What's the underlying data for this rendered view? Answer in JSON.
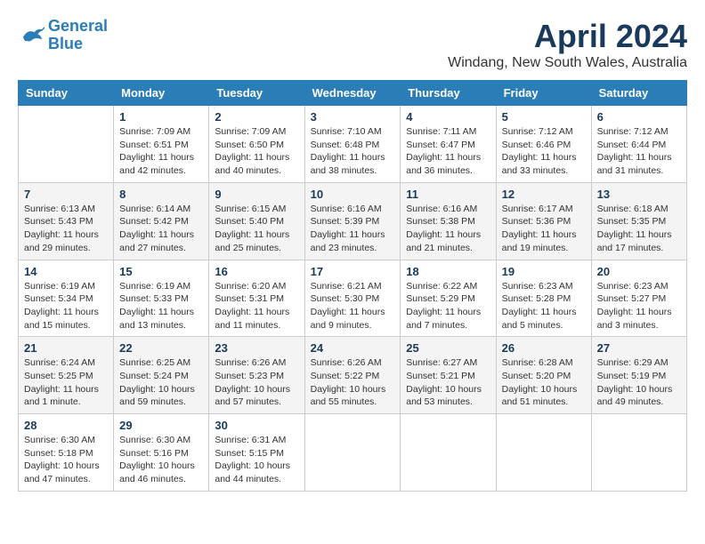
{
  "header": {
    "logo_line1": "General",
    "logo_line2": "Blue",
    "month_title": "April 2024",
    "location": "Windang, New South Wales, Australia"
  },
  "days_of_week": [
    "Sunday",
    "Monday",
    "Tuesday",
    "Wednesday",
    "Thursday",
    "Friday",
    "Saturday"
  ],
  "weeks": [
    [
      {
        "day": "",
        "info": ""
      },
      {
        "day": "1",
        "info": "Sunrise: 7:09 AM\nSunset: 6:51 PM\nDaylight: 11 hours\nand 42 minutes."
      },
      {
        "day": "2",
        "info": "Sunrise: 7:09 AM\nSunset: 6:50 PM\nDaylight: 11 hours\nand 40 minutes."
      },
      {
        "day": "3",
        "info": "Sunrise: 7:10 AM\nSunset: 6:48 PM\nDaylight: 11 hours\nand 38 minutes."
      },
      {
        "day": "4",
        "info": "Sunrise: 7:11 AM\nSunset: 6:47 PM\nDaylight: 11 hours\nand 36 minutes."
      },
      {
        "day": "5",
        "info": "Sunrise: 7:12 AM\nSunset: 6:46 PM\nDaylight: 11 hours\nand 33 minutes."
      },
      {
        "day": "6",
        "info": "Sunrise: 7:12 AM\nSunset: 6:44 PM\nDaylight: 11 hours\nand 31 minutes."
      }
    ],
    [
      {
        "day": "7",
        "info": "Sunrise: 6:13 AM\nSunset: 5:43 PM\nDaylight: 11 hours\nand 29 minutes."
      },
      {
        "day": "8",
        "info": "Sunrise: 6:14 AM\nSunset: 5:42 PM\nDaylight: 11 hours\nand 27 minutes."
      },
      {
        "day": "9",
        "info": "Sunrise: 6:15 AM\nSunset: 5:40 PM\nDaylight: 11 hours\nand 25 minutes."
      },
      {
        "day": "10",
        "info": "Sunrise: 6:16 AM\nSunset: 5:39 PM\nDaylight: 11 hours\nand 23 minutes."
      },
      {
        "day": "11",
        "info": "Sunrise: 6:16 AM\nSunset: 5:38 PM\nDaylight: 11 hours\nand 21 minutes."
      },
      {
        "day": "12",
        "info": "Sunrise: 6:17 AM\nSunset: 5:36 PM\nDaylight: 11 hours\nand 19 minutes."
      },
      {
        "day": "13",
        "info": "Sunrise: 6:18 AM\nSunset: 5:35 PM\nDaylight: 11 hours\nand 17 minutes."
      }
    ],
    [
      {
        "day": "14",
        "info": "Sunrise: 6:19 AM\nSunset: 5:34 PM\nDaylight: 11 hours\nand 15 minutes."
      },
      {
        "day": "15",
        "info": "Sunrise: 6:19 AM\nSunset: 5:33 PM\nDaylight: 11 hours\nand 13 minutes."
      },
      {
        "day": "16",
        "info": "Sunrise: 6:20 AM\nSunset: 5:31 PM\nDaylight: 11 hours\nand 11 minutes."
      },
      {
        "day": "17",
        "info": "Sunrise: 6:21 AM\nSunset: 5:30 PM\nDaylight: 11 hours\nand 9 minutes."
      },
      {
        "day": "18",
        "info": "Sunrise: 6:22 AM\nSunset: 5:29 PM\nDaylight: 11 hours\nand 7 minutes."
      },
      {
        "day": "19",
        "info": "Sunrise: 6:23 AM\nSunset: 5:28 PM\nDaylight: 11 hours\nand 5 minutes."
      },
      {
        "day": "20",
        "info": "Sunrise: 6:23 AM\nSunset: 5:27 PM\nDaylight: 11 hours\nand 3 minutes."
      }
    ],
    [
      {
        "day": "21",
        "info": "Sunrise: 6:24 AM\nSunset: 5:25 PM\nDaylight: 11 hours\nand 1 minute."
      },
      {
        "day": "22",
        "info": "Sunrise: 6:25 AM\nSunset: 5:24 PM\nDaylight: 10 hours\nand 59 minutes."
      },
      {
        "day": "23",
        "info": "Sunrise: 6:26 AM\nSunset: 5:23 PM\nDaylight: 10 hours\nand 57 minutes."
      },
      {
        "day": "24",
        "info": "Sunrise: 6:26 AM\nSunset: 5:22 PM\nDaylight: 10 hours\nand 55 minutes."
      },
      {
        "day": "25",
        "info": "Sunrise: 6:27 AM\nSunset: 5:21 PM\nDaylight: 10 hours\nand 53 minutes."
      },
      {
        "day": "26",
        "info": "Sunrise: 6:28 AM\nSunset: 5:20 PM\nDaylight: 10 hours\nand 51 minutes."
      },
      {
        "day": "27",
        "info": "Sunrise: 6:29 AM\nSunset: 5:19 PM\nDaylight: 10 hours\nand 49 minutes."
      }
    ],
    [
      {
        "day": "28",
        "info": "Sunrise: 6:30 AM\nSunset: 5:18 PM\nDaylight: 10 hours\nand 47 minutes."
      },
      {
        "day": "29",
        "info": "Sunrise: 6:30 AM\nSunset: 5:16 PM\nDaylight: 10 hours\nand 46 minutes."
      },
      {
        "day": "30",
        "info": "Sunrise: 6:31 AM\nSunset: 5:15 PM\nDaylight: 10 hours\nand 44 minutes."
      },
      {
        "day": "",
        "info": ""
      },
      {
        "day": "",
        "info": ""
      },
      {
        "day": "",
        "info": ""
      },
      {
        "day": "",
        "info": ""
      }
    ]
  ]
}
